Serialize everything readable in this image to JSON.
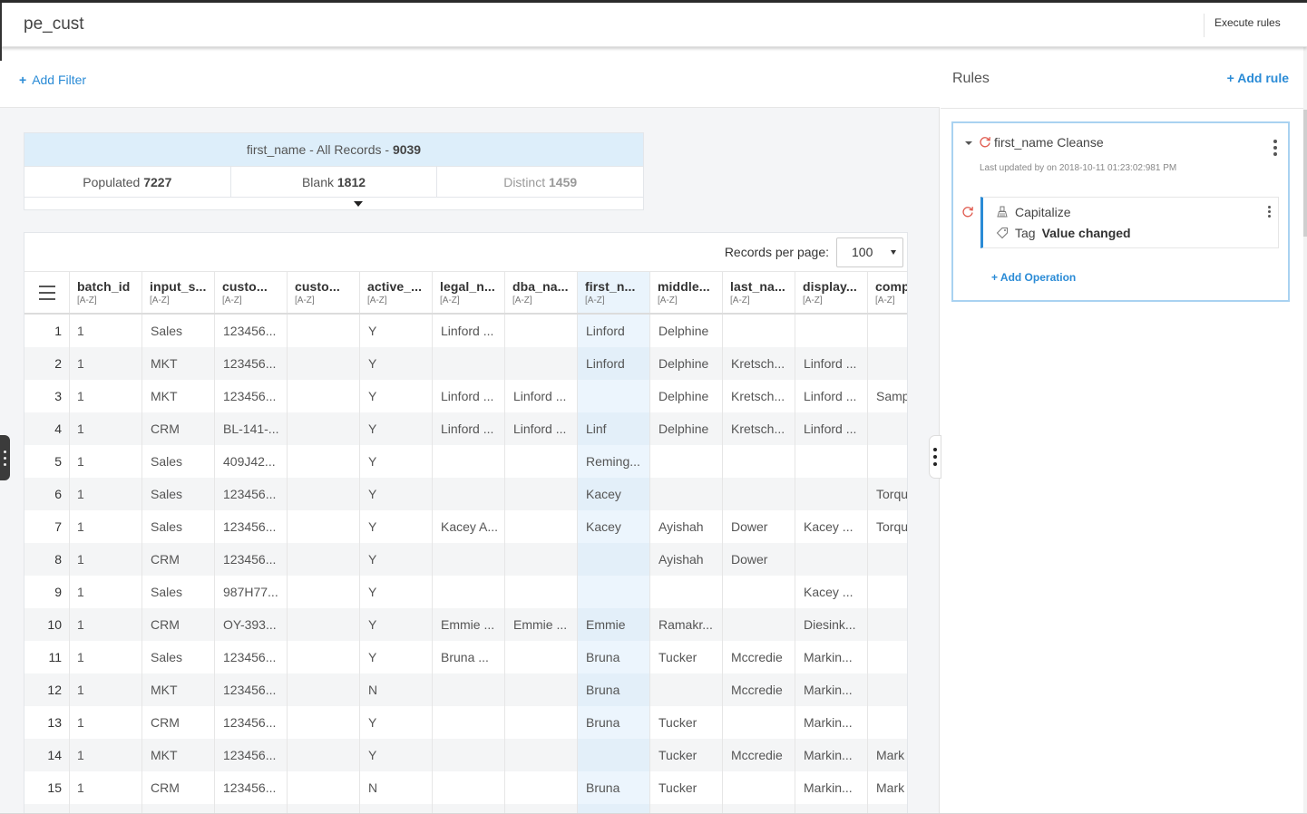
{
  "header": {
    "title": "pe_cust",
    "execute_label": "Execute rules"
  },
  "filter": {
    "add_label": "Add Filter",
    "plus": "+"
  },
  "stats": {
    "field": "first_name",
    "scope_text": "- All Records -",
    "total": "9039",
    "populated_label": "Populated",
    "populated": "7227",
    "blank_label": "Blank",
    "blank": "1812",
    "distinct_label": "Distinct",
    "distinct": "1459"
  },
  "table": {
    "records_per_page_label": "Records per page:",
    "records_per_page": "100",
    "columns": [
      {
        "name": "batch_id",
        "sort": "[A-Z]"
      },
      {
        "name": "input_s...",
        "sort": "[A-Z]"
      },
      {
        "name": "custo...",
        "sort": "[A-Z]"
      },
      {
        "name": "custo...",
        "sort": "[A-Z]"
      },
      {
        "name": "active_...",
        "sort": "[A-Z]"
      },
      {
        "name": "legal_n...",
        "sort": "[A-Z]"
      },
      {
        "name": "dba_na...",
        "sort": "[A-Z]"
      },
      {
        "name": "first_n...",
        "sort": "[A-Z]"
      },
      {
        "name": "middle...",
        "sort": "[A-Z]"
      },
      {
        "name": "last_na...",
        "sort": "[A-Z]"
      },
      {
        "name": "display...",
        "sort": "[A-Z]"
      },
      {
        "name": "comp",
        "sort": "[A-Z]"
      }
    ],
    "rows": [
      [
        "1",
        "1",
        "Sales",
        "123456...",
        "",
        "Y",
        "Linford ...",
        "",
        "Linford",
        "Delphine",
        "",
        "",
        ""
      ],
      [
        "2",
        "1",
        "MKT",
        "123456...",
        "",
        "Y",
        "",
        "",
        "Linford",
        "Delphine",
        "Kretsch...",
        "Linford ...",
        ""
      ],
      [
        "3",
        "1",
        "MKT",
        "123456...",
        "",
        "Y",
        "Linford ...",
        "Linford ...",
        "",
        "Delphine",
        "Kretsch...",
        "Linford ...",
        "Samp"
      ],
      [
        "4",
        "1",
        "CRM",
        "BL-141-...",
        "",
        "Y",
        "Linford ...",
        "Linford ...",
        "Linf",
        "Delphine",
        "Kretsch...",
        "Linford ...",
        ""
      ],
      [
        "5",
        "1",
        "Sales",
        "409J42...",
        "",
        "Y",
        "",
        "",
        "Reming...",
        "",
        "",
        "",
        ""
      ],
      [
        "6",
        "1",
        "Sales",
        "123456...",
        "",
        "Y",
        "",
        "",
        "Kacey",
        "",
        "",
        "",
        "Torqu"
      ],
      [
        "7",
        "1",
        "Sales",
        "123456...",
        "",
        "Y",
        "Kacey A...",
        "",
        "Kacey",
        "Ayishah",
        "Dower",
        "Kacey ...",
        "Torqu"
      ],
      [
        "8",
        "1",
        "CRM",
        "123456...",
        "",
        "Y",
        "",
        "",
        "",
        "Ayishah",
        "Dower",
        "",
        ""
      ],
      [
        "9",
        "1",
        "Sales",
        "987H77...",
        "",
        "Y",
        "",
        "",
        "",
        "",
        "",
        "Kacey ...",
        ""
      ],
      [
        "10",
        "1",
        "CRM",
        "OY-393...",
        "",
        "Y",
        "Emmie ...",
        "Emmie ...",
        "Emmie",
        "Ramakr...",
        "",
        "Diesink...",
        ""
      ],
      [
        "11",
        "1",
        "Sales",
        "123456...",
        "",
        "Y",
        "Bruna ...",
        "",
        "Bruna",
        "Tucker",
        "Mccredie",
        "Markin...",
        ""
      ],
      [
        "12",
        "1",
        "MKT",
        "123456...",
        "",
        "N",
        "",
        "",
        "Bruna",
        "",
        "Mccredie",
        "Markin...",
        ""
      ],
      [
        "13",
        "1",
        "CRM",
        "123456...",
        "",
        "Y",
        "",
        "",
        "Bruna",
        "Tucker",
        "",
        "Markin...",
        ""
      ],
      [
        "14",
        "1",
        "MKT",
        "123456...",
        "",
        "Y",
        "",
        "",
        "",
        "Tucker",
        "Mccredie",
        "Markin...",
        "Mark"
      ],
      [
        "15",
        "1",
        "CRM",
        "123456...",
        "",
        "N",
        "",
        "",
        "Bruna",
        "Tucker",
        "",
        "Markin...",
        "Mark"
      ],
      [
        "",
        "",
        "",
        "",
        "",
        "",
        "",
        "",
        "",
        "",
        "",
        "",
        ""
      ]
    ]
  },
  "rules": {
    "title": "Rules",
    "add_label": "+ Add rule",
    "rule": {
      "title": "first_name Cleanse",
      "meta": "Last updated by on 2018-10-11 01:23:02:981 PM",
      "op_name": "Capitalize",
      "tag_label": "Tag",
      "tag_value": "Value changed",
      "add_op_label": "+ Add Operation"
    }
  },
  "colors": {
    "accent": "#2a8bd6",
    "selected_column": "#ecf5fd",
    "refresh_icon": "#e05a4e"
  }
}
